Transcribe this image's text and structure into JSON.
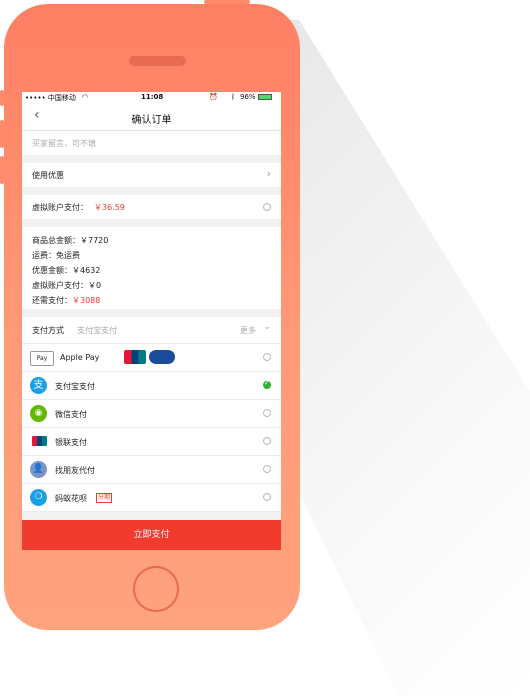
{
  "status_bar": {
    "carrier": "••••• 中国移动",
    "time": "11:08",
    "battery": "96%"
  },
  "nav": {
    "title": "确认订单"
  },
  "message": {
    "placeholder": "买家留言，可不填"
  },
  "coupon": {
    "label": "使用优惠"
  },
  "virtual_pay": {
    "label": "虚拟账户支付：",
    "amount": "￥36.59"
  },
  "summary": {
    "items": [
      {
        "label": "商品总金额：",
        "value": "￥7720"
      },
      {
        "label": "运费：",
        "value": "免运费"
      },
      {
        "label": "优惠金额：",
        "value": "￥4632"
      },
      {
        "label": "虚拟账户支付：",
        "value": "￥0"
      }
    ],
    "due_label": "还需支付：",
    "due_value": "￥3088"
  },
  "payment": {
    "header_label": "支付方式",
    "selected_method": "支付宝支付",
    "more_label": "更多",
    "methods": [
      {
        "label": "Apple Pay",
        "selected": false,
        "icon": "apple-pay-icon"
      },
      {
        "label": "支付宝支付",
        "selected": true,
        "icon": "alipay-icon"
      },
      {
        "label": "微信支付",
        "selected": false,
        "icon": "wechat-icon"
      },
      {
        "label": "银联支付",
        "selected": false,
        "icon": "unionpay-icon"
      },
      {
        "label": "找朋友代付",
        "selected": false,
        "icon": "friend-icon"
      },
      {
        "label": "蚂蚁花呗",
        "badge": "分期",
        "selected": false,
        "icon": "huabei-icon"
      }
    ]
  },
  "submit": {
    "label": "立即支付"
  },
  "colors": {
    "phone_body": "#ff8c6e",
    "accent_red": "#f23b2f",
    "check_green": "#2eae2e"
  }
}
